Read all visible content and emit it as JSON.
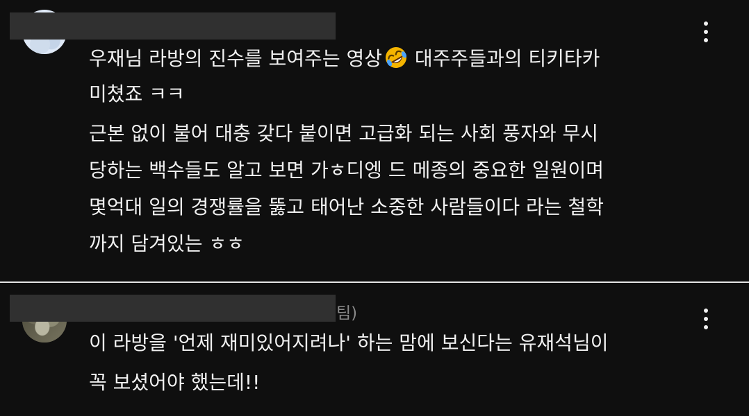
{
  "comments": [
    {
      "author_visible_suffix": "",
      "text_lines": [
        "우재님 라방의 진수를 보여주는 영상",
        " 대주주들과의 티키타카",
        "미쳤죠 ㅋㅋ",
        "근본 없이 불어 대충 갖다 붙이면 고급화 되는 사회 풍자와 무시",
        "당하는 백수들도 알고 보면 가ㅎ디엥 드 메종의 중요한 일원이며",
        "몇억대 일의 경쟁률을 뚫고 태어난 소중한 사람들이다 라는 철학",
        "까지 담겨있는 ㅎㅎ"
      ],
      "emoji": "rolling-on-floor-laughing-emoji"
    },
    {
      "author_visible_suffix": "팀)",
      "text_lines": [
        "이 라방을 '언제 재미있어지려나' 하는 맘에 보신다는 유재석님이",
        "꼭 보셨어야 했는데!!"
      ]
    }
  ],
  "icons": {
    "more": "more-vert-icon"
  },
  "colors": {
    "background": "#0f0f0f",
    "text": "#f1f1f1",
    "secondary_text": "#8a8a8a",
    "divider": "#e6e6e6"
  }
}
